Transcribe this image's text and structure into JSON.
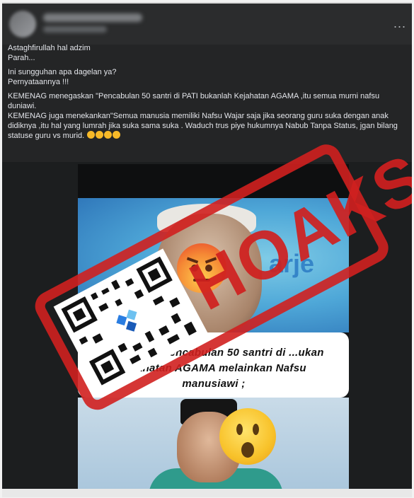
{
  "post": {
    "caption": {
      "line1": "Astaghfirullah hal adzim",
      "line2": "Parah...",
      "line3": "Ini sungguhan apa dagelan ya?",
      "line4": "Pernyataannya !!!",
      "line5": "KEMENAG menegaskan \"Pencabulan 50 santri di PATI bukanlah Kejahatan AGAMA ,itu semua murni nafsu duniawi.",
      "line6": "KEMENAG juga menekankan\"Semua manusia memiliki Nafsu Wajar saja jika seorang guru suka dengan anak didiknya ,itu hal yang lumrah jika suka sama suka . Waduch  trus piye hukumnya Nabub Tanpa Status, jgan bilang statuse guru vs murid."
    },
    "more_button": "...",
    "media": {
      "background_text": "arje",
      "banner_text": "...egaskan\"Pencabulan 50 santri di ...ukan kejahatan AGAMA melainkan Nafsu manusiawi ;",
      "emoji_top": "angry-face",
      "emoji_bottom": "face-with-open-mouth"
    },
    "stamp": {
      "text": "HOAKS",
      "color": "#d0201f"
    }
  }
}
